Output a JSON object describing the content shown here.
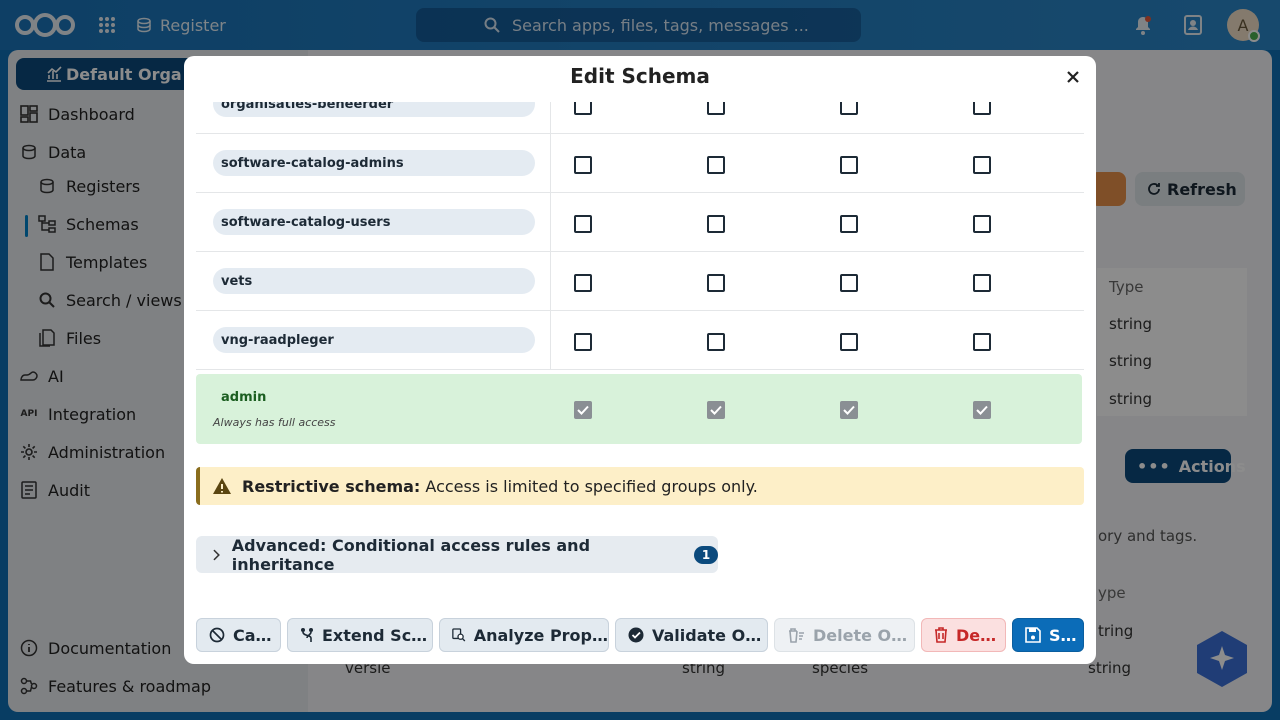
{
  "header": {
    "app_name": "Register",
    "search_placeholder": "Search apps, files, tags, messages ...",
    "avatar_letter": "A"
  },
  "sidebar": {
    "org_button": "Default Orga",
    "items": [
      {
        "label": "Dashboard",
        "icon": "dashboard-icon"
      },
      {
        "label": "Data",
        "icon": "database-icon"
      },
      {
        "label": "Registers",
        "icon": "database-icon"
      },
      {
        "label": "Schemas",
        "icon": "schema-icon"
      },
      {
        "label": "Templates",
        "icon": "file-icon"
      },
      {
        "label": "Search / views",
        "icon": "search-icon"
      },
      {
        "label": "Files",
        "icon": "files-icon"
      },
      {
        "label": "AI",
        "icon": "ai-icon"
      },
      {
        "label": "Integration",
        "icon": "api-icon"
      },
      {
        "label": "Administration",
        "icon": "gear-icon"
      },
      {
        "label": "Audit",
        "icon": "audit-icon"
      }
    ],
    "bottom_items": [
      {
        "label": "Documentation",
        "icon": "info-icon"
      },
      {
        "label": "Features & roadmap",
        "icon": "roadmap-icon"
      }
    ]
  },
  "background": {
    "refresh_label": "Refresh",
    "actions_label": "Actions",
    "type_header": "Type",
    "type_values": [
      "string",
      "string",
      "string"
    ],
    "partial_text": "ory and tags.",
    "type_header_2": "ype",
    "type_values_2": [
      "tring",
      "string"
    ],
    "versie_label": "versie",
    "versie_type": "string",
    "species_label": "species"
  },
  "modal": {
    "title": "Edit Schema",
    "groups": [
      {
        "name": "organisaties-beheerder"
      },
      {
        "name": "software-catalog-admins"
      },
      {
        "name": "software-catalog-users"
      },
      {
        "name": "vets"
      },
      {
        "name": "vng-raadpleger"
      }
    ],
    "admin": {
      "name": "admin",
      "subtitle": "Always has full access"
    },
    "warning": {
      "bold": "Restrictive schema:",
      "text": "Access is limited to specified groups only."
    },
    "advanced": {
      "label": "Advanced: Conditional access rules and inheritance",
      "count": "1"
    },
    "footer": {
      "cancel": "Ca…",
      "extend": "Extend Sc…",
      "analyze": "Analyze Prop…",
      "validate": "Validate O…",
      "delete_objects": "Delete O…",
      "delete": "De…",
      "save": "S…"
    }
  }
}
